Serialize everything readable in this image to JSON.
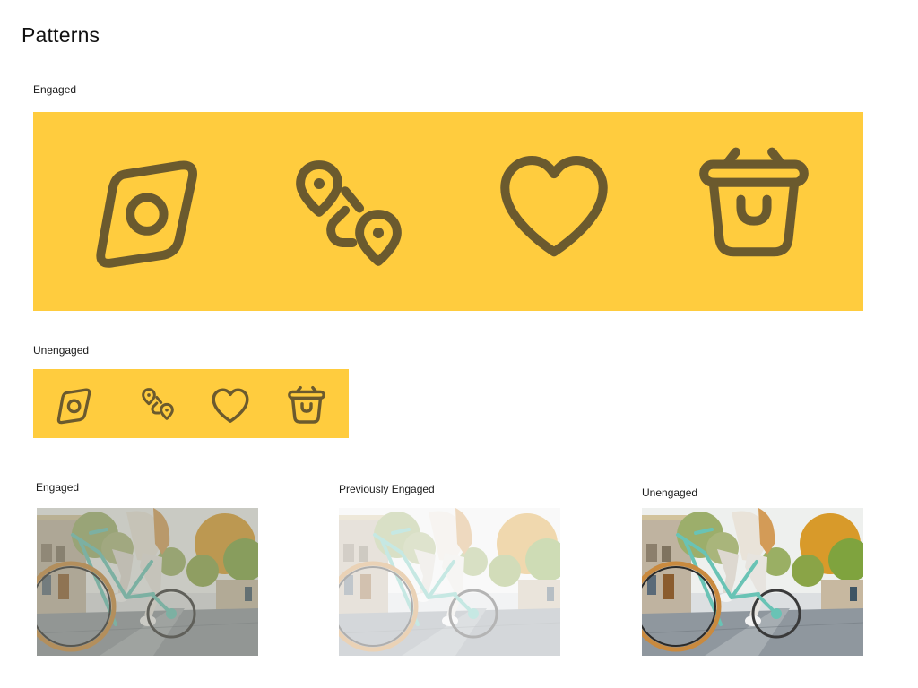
{
  "page": {
    "title": "Patterns"
  },
  "icon_patterns": {
    "engaged": {
      "label": "Engaged",
      "icons": [
        "camera-lens-icon",
        "route-pins-icon",
        "heart-icon",
        "shopping-basket-icon"
      ]
    },
    "unengaged": {
      "label": "Unengaged",
      "icons": [
        "camera-lens-icon",
        "route-pins-icon",
        "heart-icon",
        "shopping-basket-icon"
      ]
    }
  },
  "image_patterns": [
    {
      "label": "Engaged"
    },
    {
      "label": "Previously Engaged"
    },
    {
      "label": "Unengaged"
    }
  ],
  "colors": {
    "panel": "#ffcc3e",
    "icon": "#6b5a2e"
  }
}
